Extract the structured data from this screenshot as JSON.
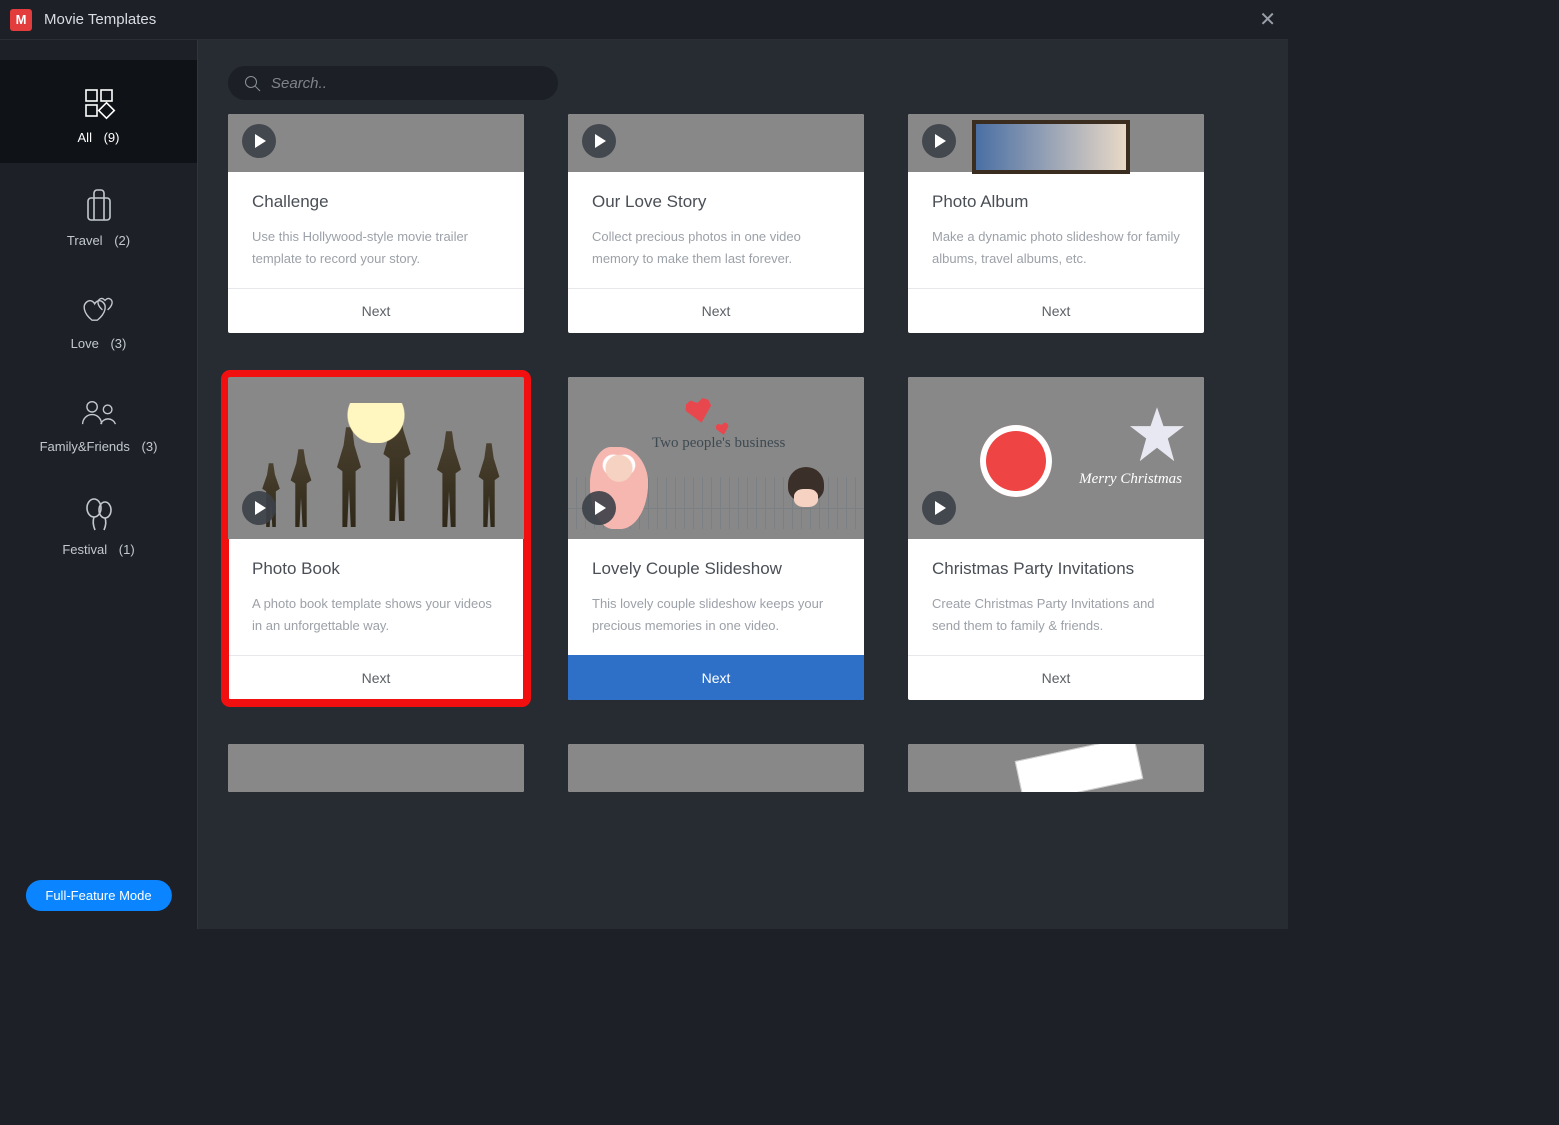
{
  "titlebar": {
    "title": "Movie Templates"
  },
  "search": {
    "placeholder": "Search.."
  },
  "sidebar": {
    "items": [
      {
        "label": "All",
        "count": "(9)",
        "icon": "grid-icon",
        "active": true
      },
      {
        "label": "Travel",
        "count": "(2)",
        "icon": "suitcase-icon"
      },
      {
        "label": "Love",
        "count": "(3)",
        "icon": "hearts-icon"
      },
      {
        "label": "Family&Friends",
        "count": "(3)",
        "icon": "people-icon"
      },
      {
        "label": "Festival",
        "count": "(1)",
        "icon": "balloons-icon"
      }
    ],
    "full_feature_label": "Full-Feature Mode"
  },
  "cards": [
    {
      "title": "Challenge",
      "desc": "Use this Hollywood-style movie trailer template to record your story.",
      "next": "Next",
      "thumb": "galaxy",
      "partial": "top"
    },
    {
      "title": "Our Love Story",
      "desc": "Collect precious photos in one video memory to make them last forever.",
      "next": "Next",
      "thumb": "petals",
      "partial": "top"
    },
    {
      "title": "Photo Album",
      "desc": "Make a dynamic photo slideshow for family albums, travel albums, etc.",
      "next": "Next",
      "thumb": "album",
      "partial": "top"
    },
    {
      "title": "Photo Book",
      "desc": "A photo book template shows your videos in an unforgettable way.",
      "next": "Next",
      "thumb": "beach",
      "highlighted": true
    },
    {
      "title": "Lovely Couple Slideshow",
      "desc": "This lovely couple slideshow keeps your precious memories in one video.",
      "next": "Next",
      "thumb": "couple",
      "hovered": true,
      "art_text": "Two people's business"
    },
    {
      "title": "Christmas Party Invitations",
      "desc": "Create Christmas Party Invitations and send them to family & friends.",
      "next": "Next",
      "thumb": "christmas",
      "art_text": "Merry Christmas"
    },
    {
      "title": "",
      "desc": "",
      "next": "",
      "thumb": "bw",
      "partial": "bottom"
    },
    {
      "title": "",
      "desc": "",
      "next": "",
      "thumb": "desk",
      "partial": "bottom"
    },
    {
      "title": "",
      "desc": "",
      "next": "",
      "thumb": "photos",
      "partial": "bottom"
    }
  ]
}
